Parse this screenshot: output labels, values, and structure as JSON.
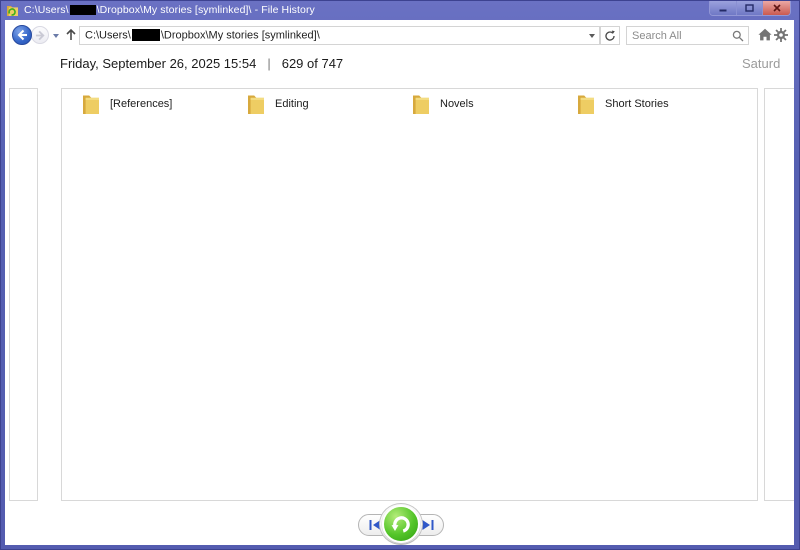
{
  "titlebar": {
    "path_prefix": "C:\\Users\\",
    "path_suffix": "\\Dropbox\\My stories [symlinked]\\ - File History",
    "app_icon": "file-history-icon",
    "controls": [
      "minimize",
      "maximize",
      "close"
    ]
  },
  "navigation": {
    "back_icon": "arrow-left",
    "forward_icon": "arrow-right",
    "up_icon": "arrow-up",
    "refresh_icon": "refresh-arrow",
    "address_prefix": "C:\\Users\\",
    "address_suffix": "\\Dropbox\\My stories [symlinked]\\",
    "search_placeholder": "Search All",
    "search_icon": "magnifier",
    "home_icon": "house",
    "settings_icon": "gear"
  },
  "header": {
    "current_snapshot_date": "Friday, September 26, 2025 15:54",
    "separator": "|",
    "snapshot_position": "629 of 747",
    "next_snapshot_date_partial": "Saturd"
  },
  "folders": [
    {
      "label": "[References]"
    },
    {
      "label": "Editing"
    },
    {
      "label": "Novels"
    },
    {
      "label": "Short Stories"
    }
  ],
  "transport": {
    "previous_icon": "skip-previous",
    "restore_icon": "restore-circular-arrow",
    "next_icon": "skip-next"
  },
  "colors": {
    "titlebar_blue": "#5b63b8",
    "restore_green": "#47b427",
    "transport_blue": "#3058c8",
    "folder_back": "#d7a93d",
    "folder_front": "#eecd63",
    "panel_border": "#d8d8d8"
  }
}
